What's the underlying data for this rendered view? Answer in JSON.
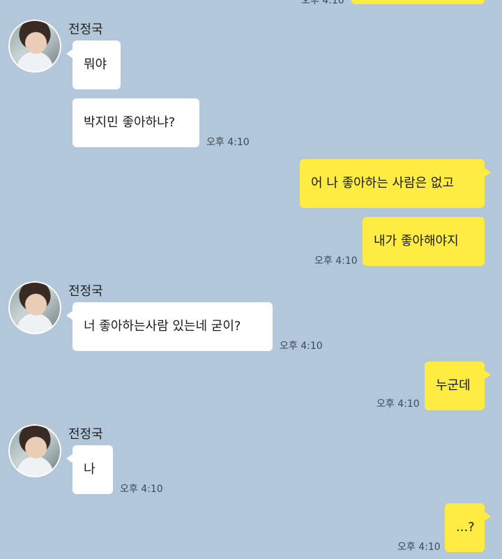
{
  "chat": {
    "top_partial_time": "오후 4:10",
    "messages": [
      {
        "sender": "전정국",
        "text": "뭐야"
      },
      {
        "text": "박지민 좋아하냐?",
        "time": "오후 4:10"
      },
      {
        "text": "어 나 좋아하는 사람은 없고"
      },
      {
        "text": "내가 좋아해야지",
        "time": "오후 4:10"
      },
      {
        "sender": "전정국",
        "text": "너 좋아하는사람 있는네 굳이?",
        "time": "오후 4:10"
      },
      {
        "text": "누군데",
        "time": "오후 4:10"
      },
      {
        "sender": "전정국",
        "text": "나",
        "time": "오후 4:10"
      },
      {
        "text": "...?",
        "time": "오후 4:10"
      }
    ]
  },
  "colors": {
    "background": "#b2c7d9",
    "incoming_bubble": "#ffffff",
    "outgoing_bubble": "#ffec42"
  }
}
